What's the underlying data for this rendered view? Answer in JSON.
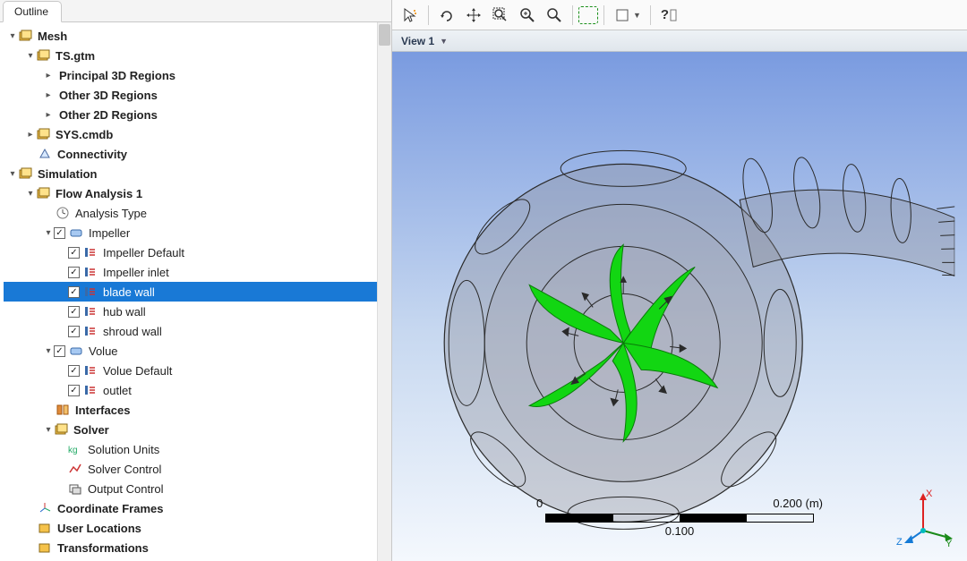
{
  "tabs": {
    "outline": "Outline"
  },
  "tree": {
    "mesh": "Mesh",
    "ts_gtm": "TS.gtm",
    "principal_3d": "Principal 3D Regions",
    "other_3d": "Other 3D Regions",
    "other_2d": "Other 2D Regions",
    "sys_cmdb": "SYS.cmdb",
    "connectivity": "Connectivity",
    "simulation": "Simulation",
    "flow_analysis": "Flow Analysis 1",
    "analysis_type": "Analysis Type",
    "impeller": "Impeller",
    "impeller_default": "Impeller Default",
    "impeller_inlet": "Impeller inlet",
    "blade_wall": "blade wall",
    "hub_wall": "hub wall",
    "shroud_wall": "shroud wall",
    "volue": "Volue",
    "volue_default": "Volue Default",
    "outlet": "outlet",
    "interfaces": "Interfaces",
    "solver": "Solver",
    "solution_units": "Solution Units",
    "solver_control": "Solver Control",
    "output_control": "Output Control",
    "coord_frames": "Coordinate Frames",
    "user_locations": "User Locations",
    "transformations": "Transformations"
  },
  "toolbar": {
    "pick": "pick",
    "fit": "fit",
    "pan": "pan",
    "zoom_box": "zoom-box",
    "zoom_in": "zoom-in",
    "zoom_out": "zoom-out",
    "box_select": "box-select",
    "face_color": "face-color",
    "help": "help"
  },
  "view": {
    "label": "View 1"
  },
  "scale": {
    "zero": "0",
    "mid": "0.100",
    "end": "0.200",
    "unit": "(m)"
  },
  "triad": {
    "x": "X",
    "y": "Y",
    "z": "Z"
  }
}
